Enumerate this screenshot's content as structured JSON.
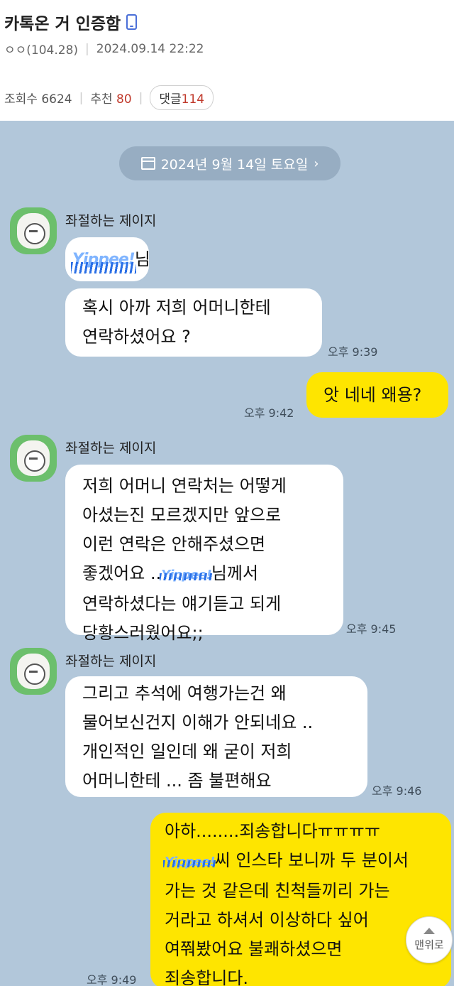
{
  "post": {
    "title": "카톡온 거 인증함",
    "author": "ㅇㅇ(104.28)",
    "datetime": "2024.09.14 22:22",
    "views_label": "조회수 6624",
    "recommend_label": "추천",
    "recommend_count": "80",
    "comments_label": "댓글",
    "comments_count": "114"
  },
  "chat": {
    "date": "2024년 9월 14일 토요일",
    "sender_name": "좌절하는 제이지",
    "sticker_text": "Yippee!",
    "messages": [
      {
        "text_suffix": "님"
      },
      {
        "line1": "혹시 아까 저희 어머니한테",
        "line2": "연락하셨어요 ?",
        "time": "오후 9:39"
      },
      {
        "line1": "앗 네네 왜용?",
        "time": "오후 9:42"
      },
      {
        "line1": "저희 어머니 연락처는 어떻게",
        "line2": "아셨는진 모르겠지만 앞으로",
        "line3": "이런 연락은 안해주셨으면",
        "line4a": "좋겠어요 ..",
        "line4b": "님께서",
        "line5": "연락하셨다는 얘기듣고 되게",
        "line6": "당황스러웠어요;;",
        "time": "오후 9:45"
      },
      {
        "line1": "그리고 추석에 여행가는건 왜",
        "line2": "물어보신건지 이해가 안되네요 ..",
        "line3": "개인적인 일인데 왜 굳이 저희",
        "line4": "어머니한테 ... 좀 불편해요",
        "time": "오후 9:46"
      },
      {
        "line1": "아하........죄송합니다ㅠㅠㅠㅠ",
        "line2b": "씨 인스타 보니까 두 분이서",
        "line3": "가는 것 같은데 친척들끼리 가는",
        "line4": "거라고 하셔서 이상하다 싶어",
        "line5": "여쭤봤어요 불쾌하셨으면",
        "line6": "죄송합니다.",
        "time": "오후 9:49"
      }
    ]
  },
  "top_button_label": "맨위로"
}
